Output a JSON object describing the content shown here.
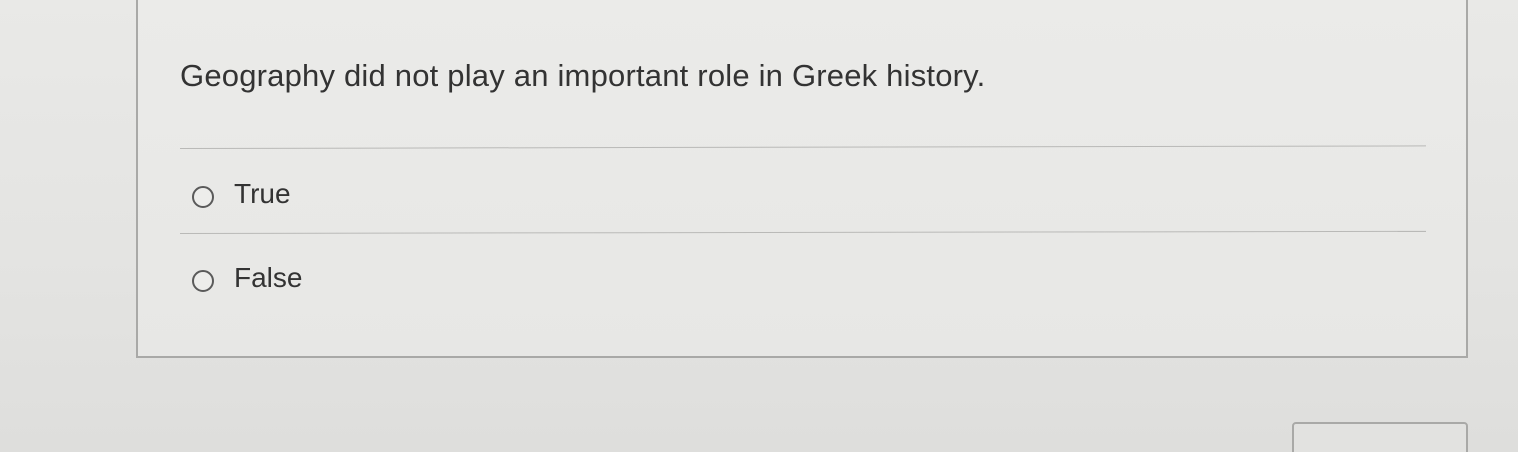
{
  "question": {
    "text": "Geography did not play an important role in Greek history."
  },
  "options": [
    {
      "label": "True",
      "selected": false
    },
    {
      "label": "False",
      "selected": false
    }
  ],
  "colors": {
    "background": "#e6e6e4",
    "card_border": "#a9a9a7",
    "text": "#333333",
    "radio_border": "#5a5a5a"
  }
}
